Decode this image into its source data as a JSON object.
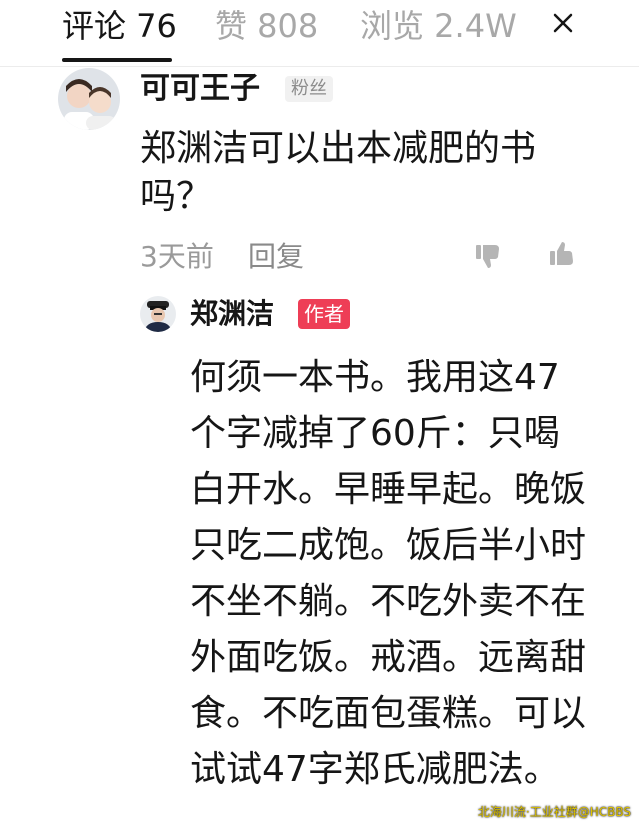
{
  "tabs": {
    "comments": "评论 76",
    "likes": "赞 808",
    "views": "浏览 2.4W",
    "close_glyph": "×"
  },
  "comment": {
    "user": "可可王子",
    "badge": "粉丝",
    "text": "郑渊洁可以出本减肥的书吗？",
    "time": "3天前",
    "reply_label": "回复",
    "dislike_icon": "thumbs-down-icon",
    "like_icon": "thumbs-up-icon"
  },
  "reply": {
    "user": "郑渊洁",
    "badge": "作者",
    "text": "何须一本书。我用这47个字减掉了60斤：只喝白开水。早睡早起。晚饭只吃二成饱。饭后半小时不坐不躺。不吃外卖不在外面吃饭。戒酒。远离甜食。不吃面包蛋糕。可以试试47字郑氏减肥法。"
  },
  "watermark": "北海川流·工业社群@HCBBS",
  "colors": {
    "text": "#161616",
    "muted": "#9a9a9a",
    "author_badge": "#ee3e56",
    "fan_badge_bg": "#f1f1f1"
  }
}
